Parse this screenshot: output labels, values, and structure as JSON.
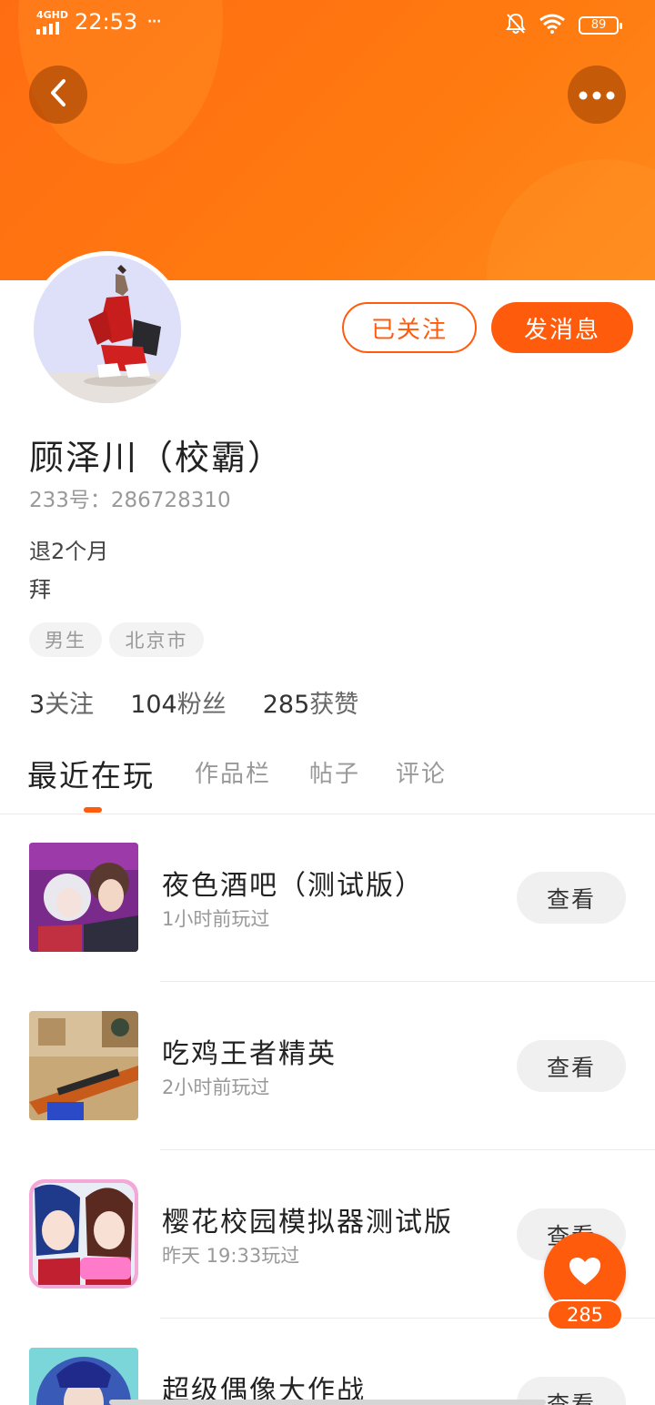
{
  "status_bar": {
    "network": "4GHD",
    "time": "22:53",
    "dots": "···",
    "battery": "89"
  },
  "profile": {
    "name": "顾泽川（校霸）",
    "id_label": "233号：",
    "id_value": "286728310",
    "bio_lines": [
      "退2个月",
      "拜"
    ],
    "tags": [
      "男生",
      "北京市"
    ]
  },
  "actions": {
    "follow_label": "已关注",
    "message_label": "发消息"
  },
  "stats": [
    {
      "value": "3",
      "label": "关注"
    },
    {
      "value": "104",
      "label": "粉丝"
    },
    {
      "value": "285",
      "label": "获赞"
    }
  ],
  "tabs": [
    {
      "label": "最近在玩",
      "active": true
    },
    {
      "label": "作品栏",
      "active": false
    },
    {
      "label": "帖子",
      "active": false
    },
    {
      "label": "评论",
      "active": false
    }
  ],
  "games": [
    {
      "title": "夜色酒吧（测试版）",
      "time": "1小时前玩过",
      "button": "查看"
    },
    {
      "title": "吃鸡王者精英",
      "time": "2小时前玩过",
      "button": "查看"
    },
    {
      "title": "樱花校园模拟器测试版",
      "time": "昨天 19:33玩过",
      "button": "查看"
    },
    {
      "title": "超级偶像大作战",
      "time": "",
      "button": "查看"
    }
  ],
  "like": {
    "count": "285"
  },
  "colors": {
    "accent": "#ff5b0d",
    "header": "#ff7a10"
  }
}
